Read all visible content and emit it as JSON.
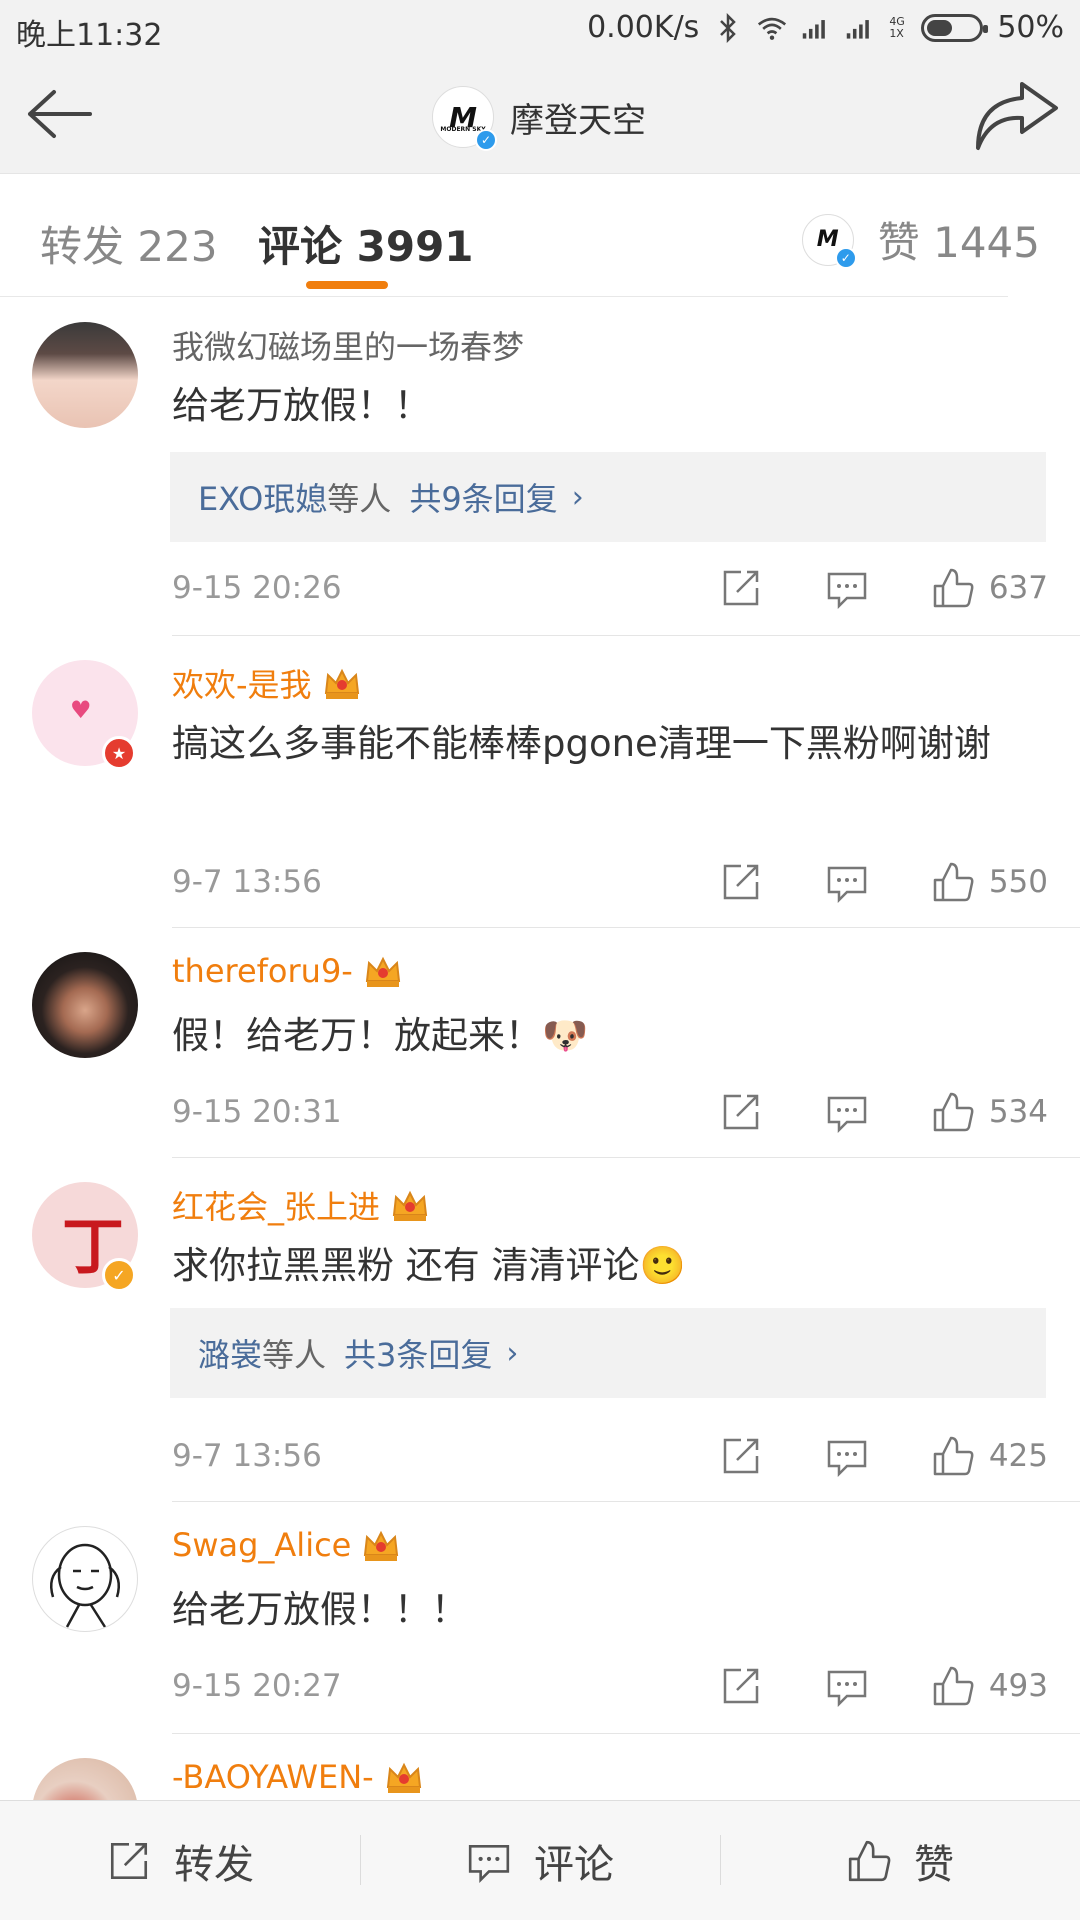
{
  "status": {
    "time": "晚上11:32",
    "network_speed": "0.00K/s",
    "signal_label": "4G\n1X",
    "battery_percent": "50%",
    "battery_level": 0.5
  },
  "header": {
    "title": "摩登天空",
    "logo_text": "M",
    "logo_subtext": "MODERN SKY"
  },
  "tabs": {
    "repost": "转发 223",
    "comments": "评论 3991",
    "likes": "赞 1445"
  },
  "comments": [
    {
      "username": "我微幻磁场里的一场春梦",
      "vip": false,
      "text": "给老万放假！！",
      "replies": {
        "names": "EXO珉媳",
        "suffix": "等人",
        "count": "共9条回复"
      },
      "time": "9-15 20:26",
      "likes": "637"
    },
    {
      "username": "欢欢-是我",
      "vip": true,
      "text": "搞这么多事能不能棒棒pgone清理一下黑粉啊谢谢",
      "replies": null,
      "time": "9-7 13:56",
      "likes": "550"
    },
    {
      "username": "thereforu9-",
      "vip": true,
      "text": "假！给老万！放起来！🐶",
      "replies": null,
      "time": "9-15 20:31",
      "likes": "534"
    },
    {
      "username": "红花会_张上进",
      "vip": true,
      "text": "求你拉黑黑粉 还有 清清评论🙂",
      "replies": {
        "names": "潞裳",
        "suffix": "等人",
        "count": "共3条回复"
      },
      "time": "9-7 13:56",
      "likes": "425"
    },
    {
      "username": "Swag_Alice",
      "vip": true,
      "text": "给老万放假！！！",
      "replies": null,
      "time": "9-15 20:27",
      "likes": "493"
    },
    {
      "username": "-BAOYAWEN-",
      "vip": true
    }
  ],
  "bottom_bar": {
    "repost": "转发",
    "comment": "评论",
    "like": "赞"
  },
  "colors": {
    "accent_orange": "#f07e0e",
    "link_blue": "#4a6c9a",
    "verified_blue": "#2e9bec"
  }
}
